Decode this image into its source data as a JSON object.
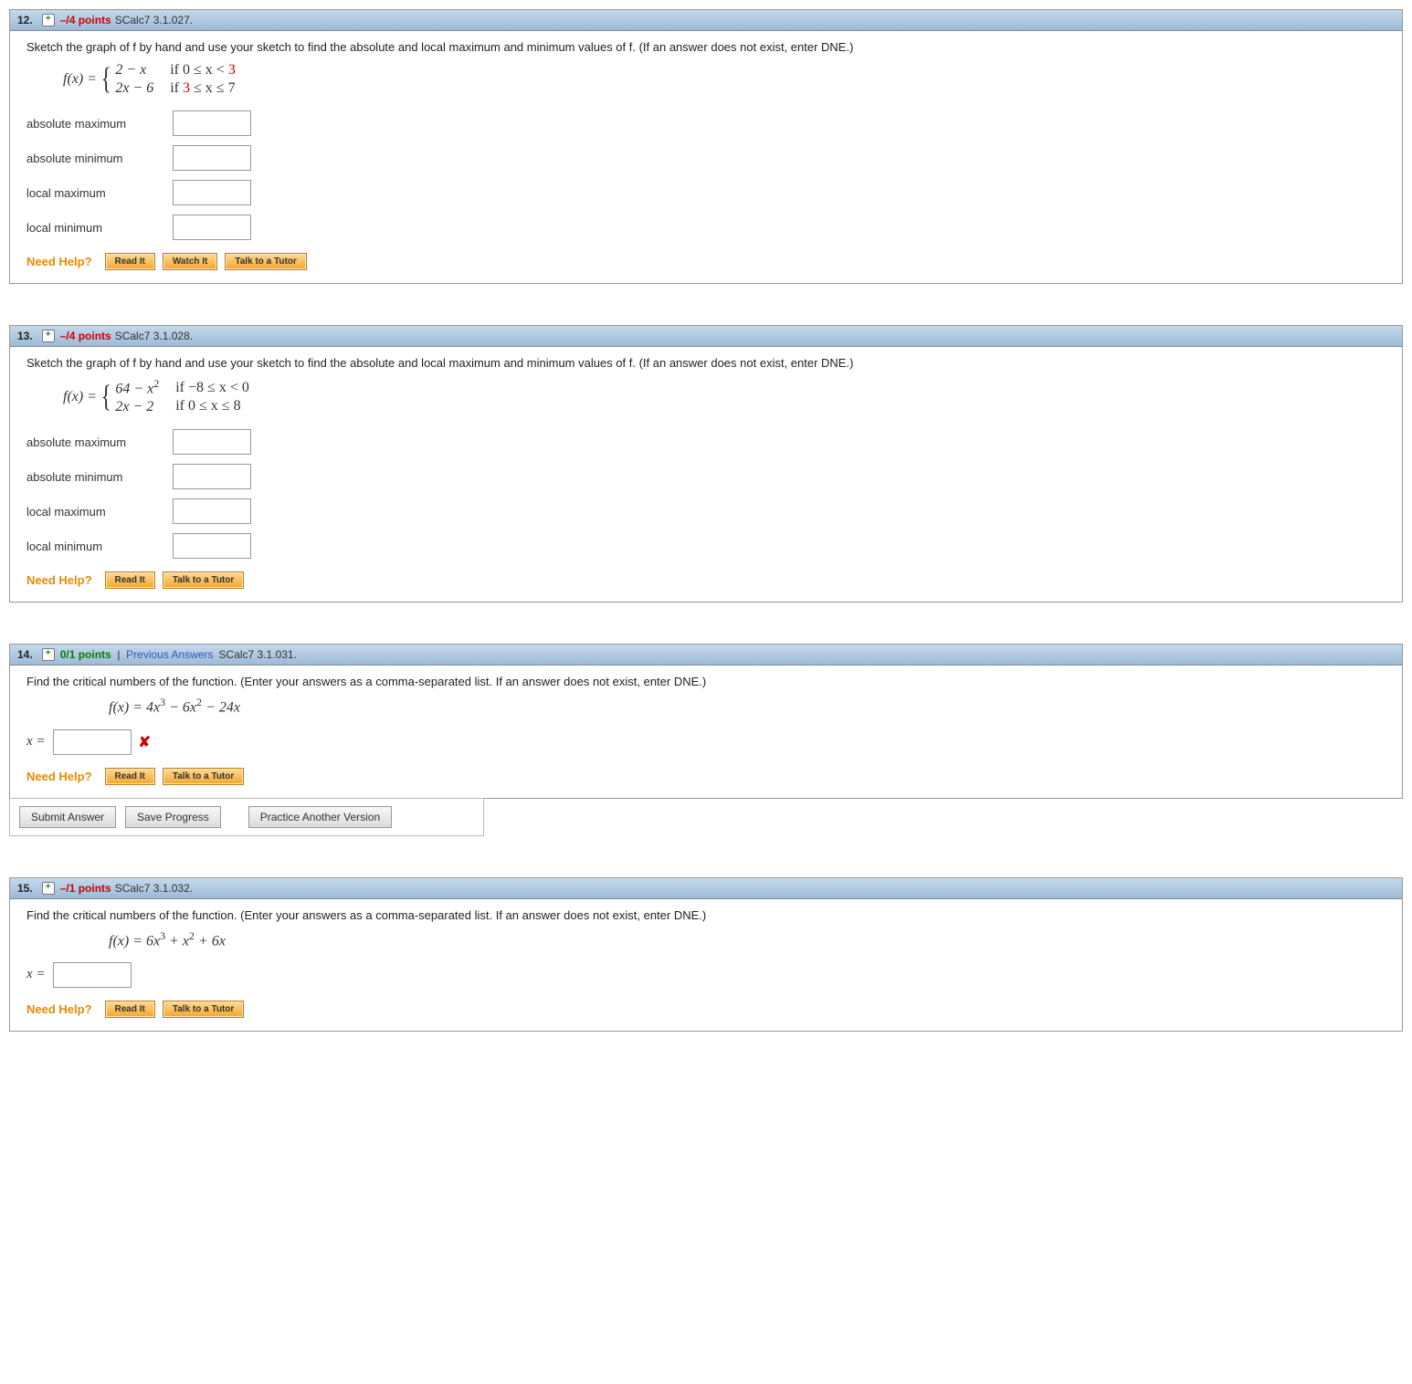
{
  "q12": {
    "number": "12.",
    "points": "–/4 points",
    "ref": "SCalc7 3.1.027.",
    "instr": "Sketch the graph of f by hand and use your sketch to find the absolute and local maximum and minimum values of f. (If an answer does not exist, enter DNE.)",
    "fx_label": "f(x) = ",
    "pieces": {
      "p1": "2 − x",
      "p2": "2x − 6",
      "c1_a": "if 0 ≤ x < ",
      "c1_b": "3",
      "c2_a": "if ",
      "c2_b": "3",
      "c2_c": " ≤ x ≤ 7"
    },
    "labels": {
      "absmax": "absolute maximum",
      "absmin": "absolute minimum",
      "locmax": "local maximum",
      "locmin": "local minimum"
    },
    "help": {
      "label": "Need Help?",
      "read": "Read It",
      "watch": "Watch It",
      "tutor": "Talk to a Tutor"
    }
  },
  "q13": {
    "number": "13.",
    "points": "–/4 points",
    "ref": "SCalc7 3.1.028.",
    "instr": "Sketch the graph of f by hand and use your sketch to find the absolute and local maximum and minimum values of f. (If an answer does not exist, enter DNE.)",
    "fx_label": "f(x) = ",
    "pieces": {
      "p1_a": "64 − x",
      "p1_b": "2",
      "p2": "2x − 2",
      "c1": "if −8 ≤ x < 0",
      "c2": "if 0 ≤ x ≤ 8"
    },
    "labels": {
      "absmax": "absolute maximum",
      "absmin": "absolute minimum",
      "locmax": "local maximum",
      "locmin": "local minimum"
    },
    "help": {
      "label": "Need Help?",
      "read": "Read It",
      "tutor": "Talk to a Tutor"
    }
  },
  "q14": {
    "number": "14.",
    "points": "0/1 points",
    "sep": "  |  ",
    "prev": "Previous Answers",
    "ref": "SCalc7 3.1.031.",
    "instr": "Find the critical numbers of the function. (Enter your answers as a comma-separated list. If an answer does not exist, enter DNE.)",
    "eq_a": "f(x) = 4x",
    "eq_b": "3",
    "eq_c": " − 6x",
    "eq_d": "2",
    "eq_e": " − 24x",
    "xlabel": "x = ",
    "help": {
      "label": "Need Help?",
      "read": "Read It",
      "tutor": "Talk to a Tutor"
    },
    "footer": {
      "submit": "Submit Answer",
      "save": "Save Progress",
      "practice": "Practice Another Version"
    }
  },
  "q15": {
    "number": "15.",
    "points": "–/1 points",
    "ref": "SCalc7 3.1.032.",
    "instr": "Find the critical numbers of the function. (Enter your answers as a comma-separated list. If an answer does not exist, enter DNE.)",
    "eq_a": "f(x) = 6x",
    "eq_b": "3",
    "eq_c": " + x",
    "eq_d": "2",
    "eq_e": " + 6x",
    "xlabel": "x = ",
    "help": {
      "label": "Need Help?",
      "read": "Read It",
      "tutor": "Talk to a Tutor"
    }
  }
}
